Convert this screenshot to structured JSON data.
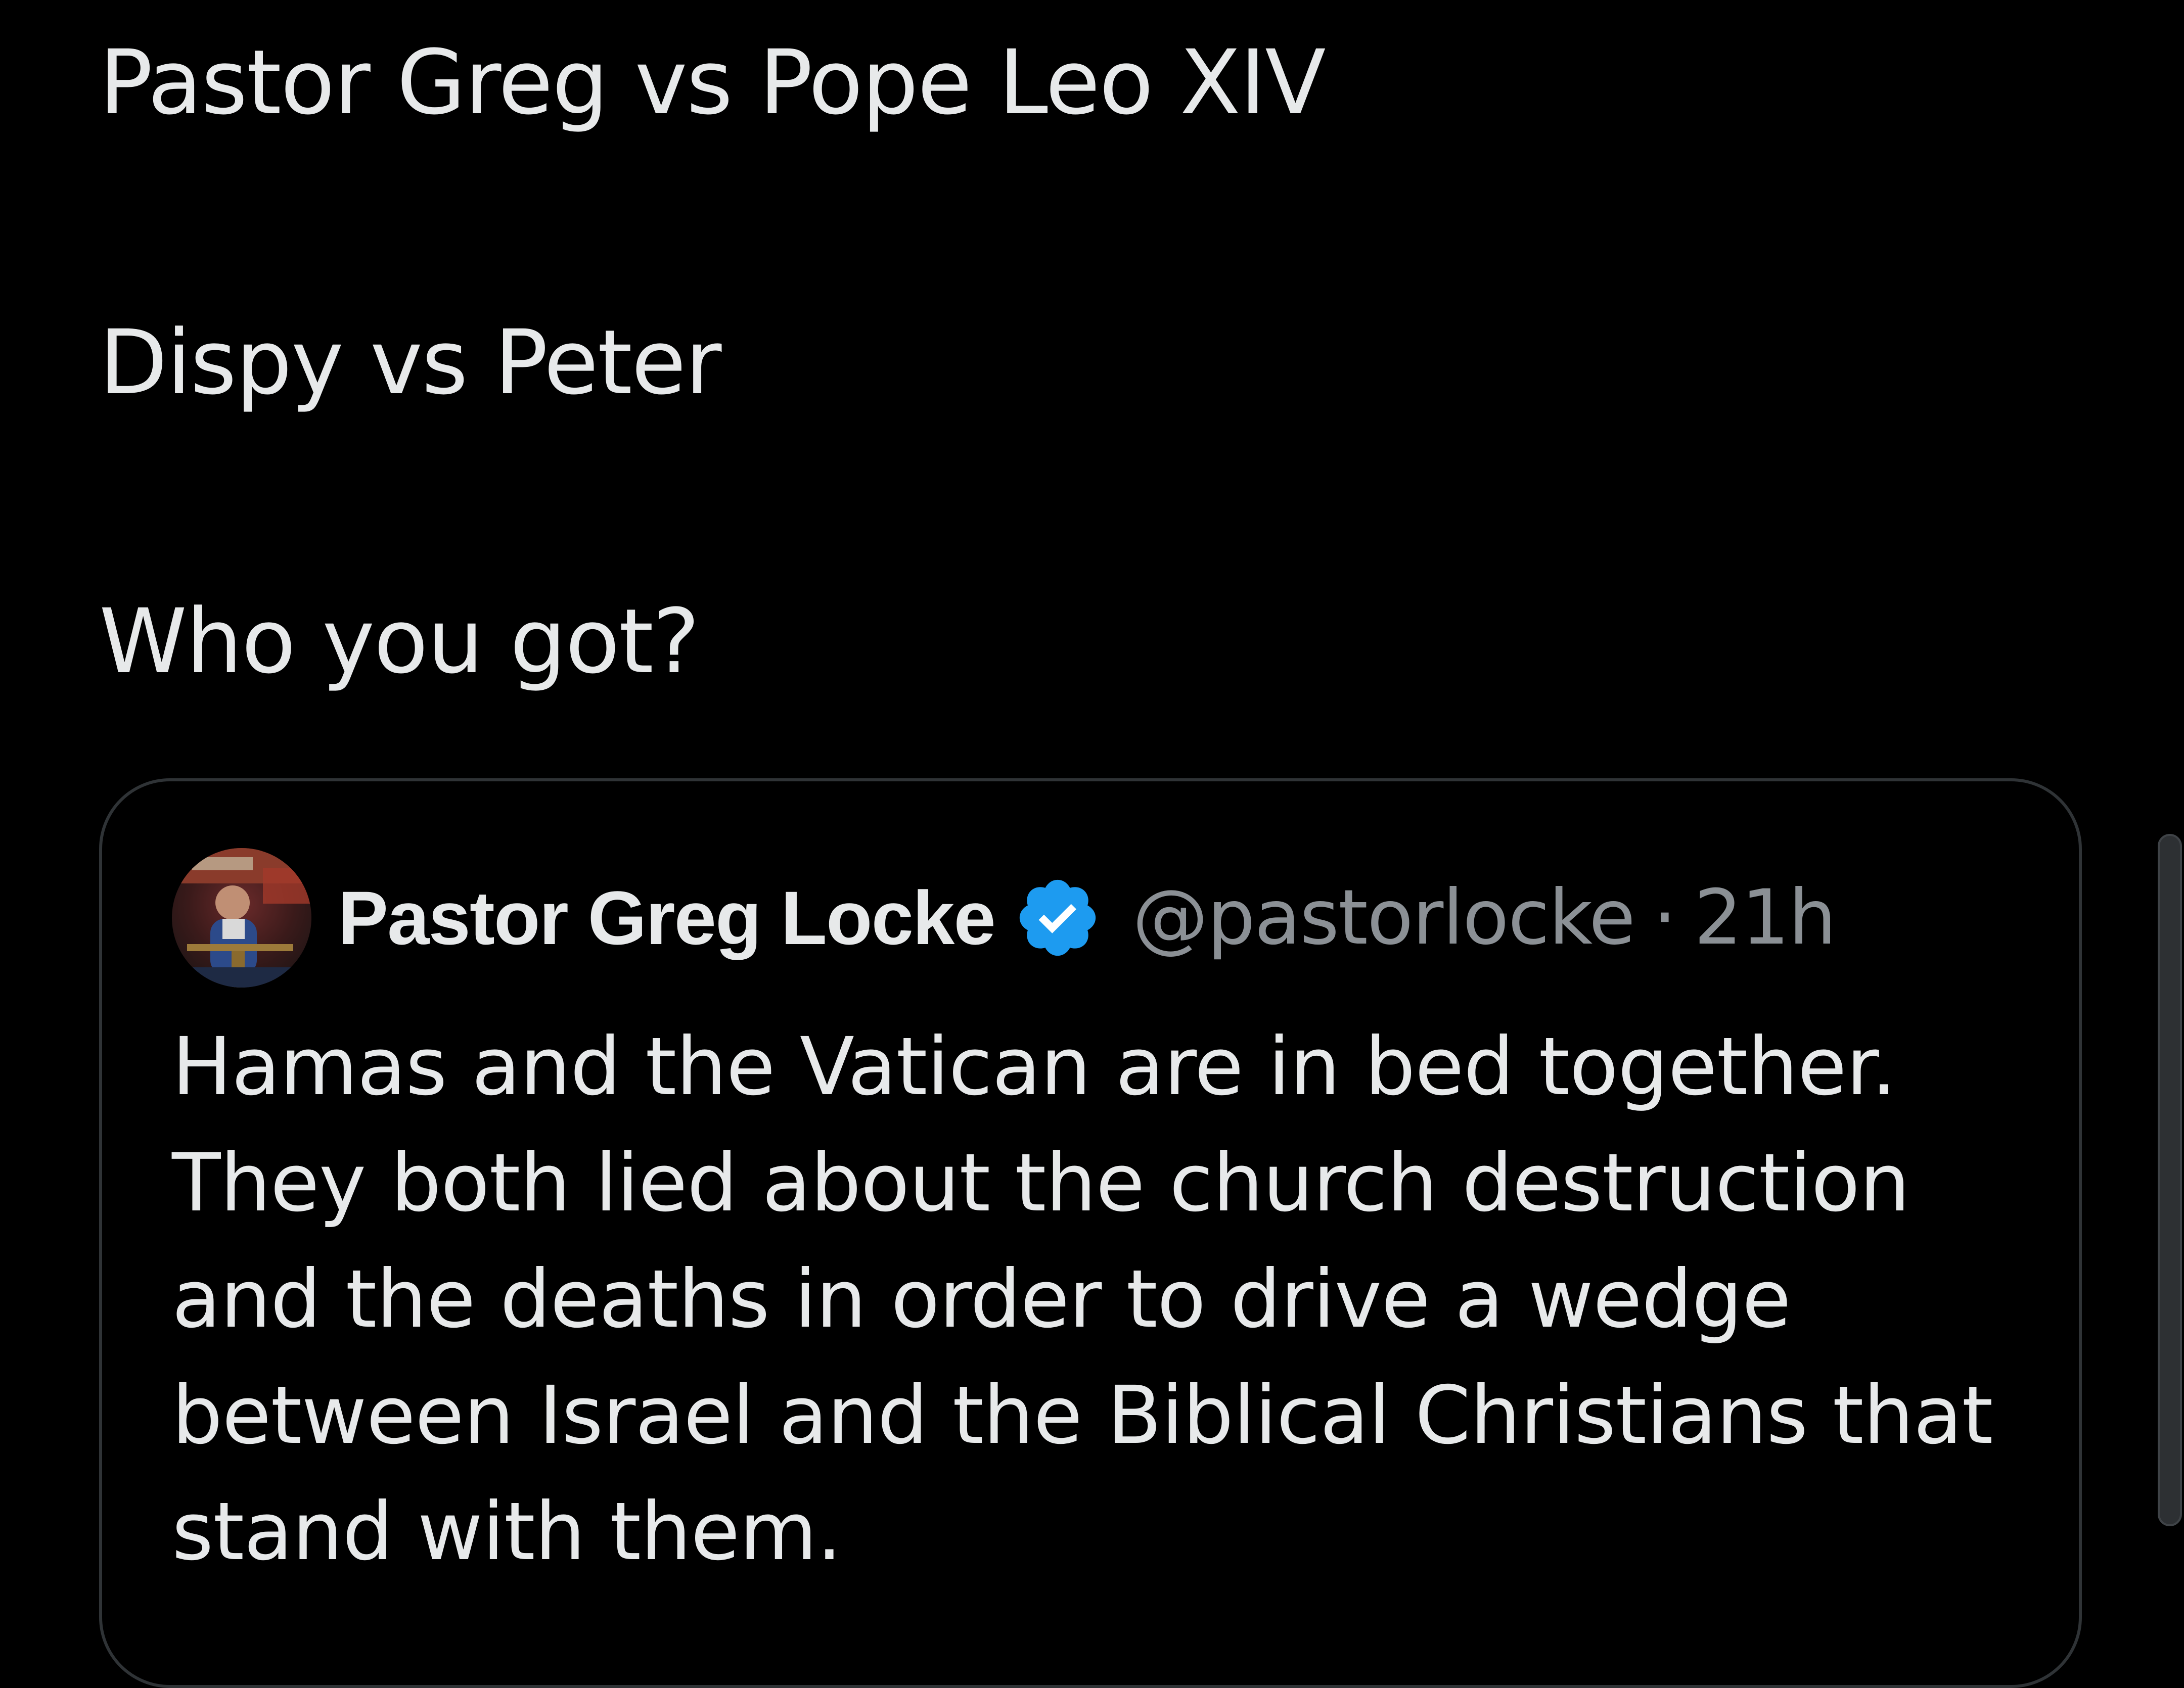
{
  "post": {
    "lines": [
      "Pastor Greg vs Pope Leo XIV",
      "Dispy vs Peter",
      "Who you got?"
    ]
  },
  "quoted_post": {
    "display_name": "Pastor Greg Locke",
    "verified": true,
    "handle": "@pastorlocke",
    "separator": "·",
    "time": "21h",
    "text_lines": [
      "Hamas and the Vatican are in bed together.",
      "They both lied about the church destruction",
      "and the deaths in order to drive a wedge",
      "between Israel and the Biblical Christians that",
      "stand with them."
    ],
    "avatar_icon": "avatar-photo",
    "badge_icon": "verified-badge-icon"
  },
  "colors": {
    "background": "#000000",
    "text": "#e7e9ea",
    "secondary_text": "#8b9095",
    "card_border": "#2f3336",
    "verified_blue": "#1d9bf0"
  }
}
